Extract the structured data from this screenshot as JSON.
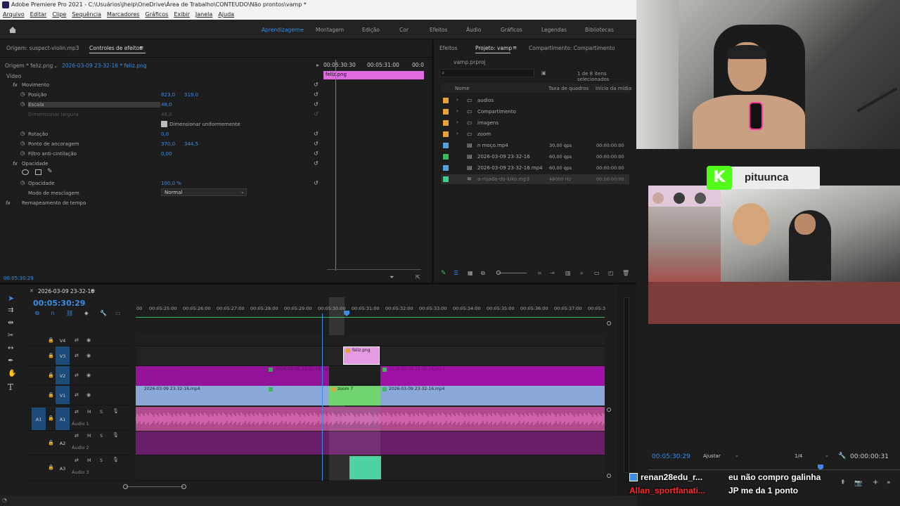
{
  "app": {
    "title": "Adobe Premiere Pro 2021 - C:\\Usuários\\jheip\\OneDrive\\Área de Trabalho\\CONTEUDO\\Não prontos\\vamp *"
  },
  "menu": [
    "Arquivo",
    "Editar",
    "Clipe",
    "Sequência",
    "Marcadores",
    "Gráficos",
    "Exibir",
    "Janela",
    "Ajuda"
  ],
  "workspaces": [
    "Aprendizagem",
    "Montagem",
    "Edição",
    "Cor",
    "Efeitos",
    "Áudio",
    "Gráficos",
    "Legendas",
    "Bibliotecas"
  ],
  "effects_panel": {
    "source_tab": "Origem: suspect-violin.mp3",
    "active_tab": "Controles de efeitos",
    "clip_master": "Origem * feliz.png",
    "clip_seq": "2026-03-09 23-32-16 * feliz.png",
    "ruler": [
      "00:05:30:30",
      "00:05:31:00",
      "00:0"
    ],
    "mini_clip": "feliz.png",
    "video_label": "Vídeo",
    "rows": [
      {
        "label": "Movimento",
        "v1": "",
        "v2": ""
      },
      {
        "label": "Posição",
        "v1": "823,0",
        "v2": "319,0"
      },
      {
        "label": "Escala",
        "v1": "48,0",
        "v2": ""
      },
      {
        "label": "Dimensionar largura",
        "v1": "48,0",
        "v2": ""
      },
      {
        "label": "Dimensionar uniformemente",
        "v1": "",
        "v2": ""
      },
      {
        "label": "Rotação",
        "v1": "0,0",
        "v2": ""
      },
      {
        "label": "Ponto de ancoragem",
        "v1": "370,0",
        "v2": "344,5"
      },
      {
        "label": "Filtro anti-cintilação",
        "v1": "0,00",
        "v2": ""
      },
      {
        "label": "Opacidade",
        "v1": "",
        "v2": ""
      },
      {
        "label": "Opacidade",
        "v1": "100,0 %",
        "v2": ""
      },
      {
        "label": "Modo de mesclagem",
        "v1": "Normal",
        "v2": ""
      },
      {
        "label": "Remapeamento de tempo",
        "v1": "",
        "v2": ""
      }
    ],
    "timecode": "00:05:30:29"
  },
  "project": {
    "tabs": [
      "Efeitos",
      "Projeto: vamp",
      "Compartimento: Compartimento"
    ],
    "file": "vamp.prproj",
    "selected": "1 de 8 itens selecionados",
    "cols": [
      "Nome",
      "Taxa de quadros",
      "Início da mídia"
    ],
    "items": [
      {
        "name": "audios",
        "rate": "",
        "start": "",
        "color": "#e2a33a"
      },
      {
        "name": "Compartimento",
        "rate": "",
        "start": "",
        "color": "#e2a33a"
      },
      {
        "name": "imagens",
        "rate": "",
        "start": "",
        "color": "#e2a33a"
      },
      {
        "name": "zoom",
        "rate": "",
        "start": "",
        "color": "#e2a33a"
      },
      {
        "name": "n moço.mp4",
        "rate": "30,00 qps",
        "start": "00:00:00:00",
        "color": "#5aa0d8"
      },
      {
        "name": "2026-03-09 23-32-16",
        "rate": "60,00 qps",
        "start": "00:00:00:00",
        "color": "#3cba5a"
      },
      {
        "name": "2026-03-09 23-32-16.mp4",
        "rate": "60,00 qps",
        "start": "00:00:00:00",
        "color": "#5aa0d8"
      },
      {
        "name": "a-risada-do-kiko.mp3",
        "rate": "48000 Hz",
        "start": "00:00:00:00",
        "color": "#3ccf8e"
      }
    ]
  },
  "timeline": {
    "sequence": "2026-03-09 23-32-16",
    "timecode": "00:05:30:29",
    "ruler": [
      "00",
      "00:05:25:00",
      "00:05:26:00",
      "00:05:27:00",
      "00:05:28:00",
      "00:05:29:00",
      "00:05:30:00",
      "00:05:31:00",
      "00:05:32:00",
      "00:05:33:00",
      "00:05:34:00",
      "00:05:35:00",
      "00:05:36:00",
      "00:05:37:00",
      "00:05:3"
    ],
    "tracks": [
      "V4",
      "V3",
      "V2",
      "V1",
      "A1",
      "A2",
      "A3"
    ],
    "track_names": {
      "a1": "Áudio 1",
      "a2": "Áudio 2",
      "a3": "Áudio 3"
    },
    "clips": {
      "feliz": "feliz.png",
      "v1a": "2026-03-09 23-32-16.mp4",
      "zoom": "zoom 7",
      "v1b": "2026-03-09 23-32-16.mp4",
      "v2a": "2026-03-09 23-32-16.mp4",
      "v2b": "2026-03-09 23-32-16.mp4"
    }
  },
  "program": {
    "timecode": "00:05:30:29",
    "fit": "Ajustar",
    "quality": "1/4",
    "duration": "00:00:00:31"
  },
  "overlay": {
    "name": "pituunca",
    "k": "K"
  },
  "chat": [
    {
      "user": "renan28edu_r...",
      "msg": "eu não compro galinha",
      "color": "#ffffff"
    },
    {
      "user": "Allan_sportfanati...",
      "msg": "JP me da 1 ponto",
      "color": "#ff2a2a"
    }
  ]
}
